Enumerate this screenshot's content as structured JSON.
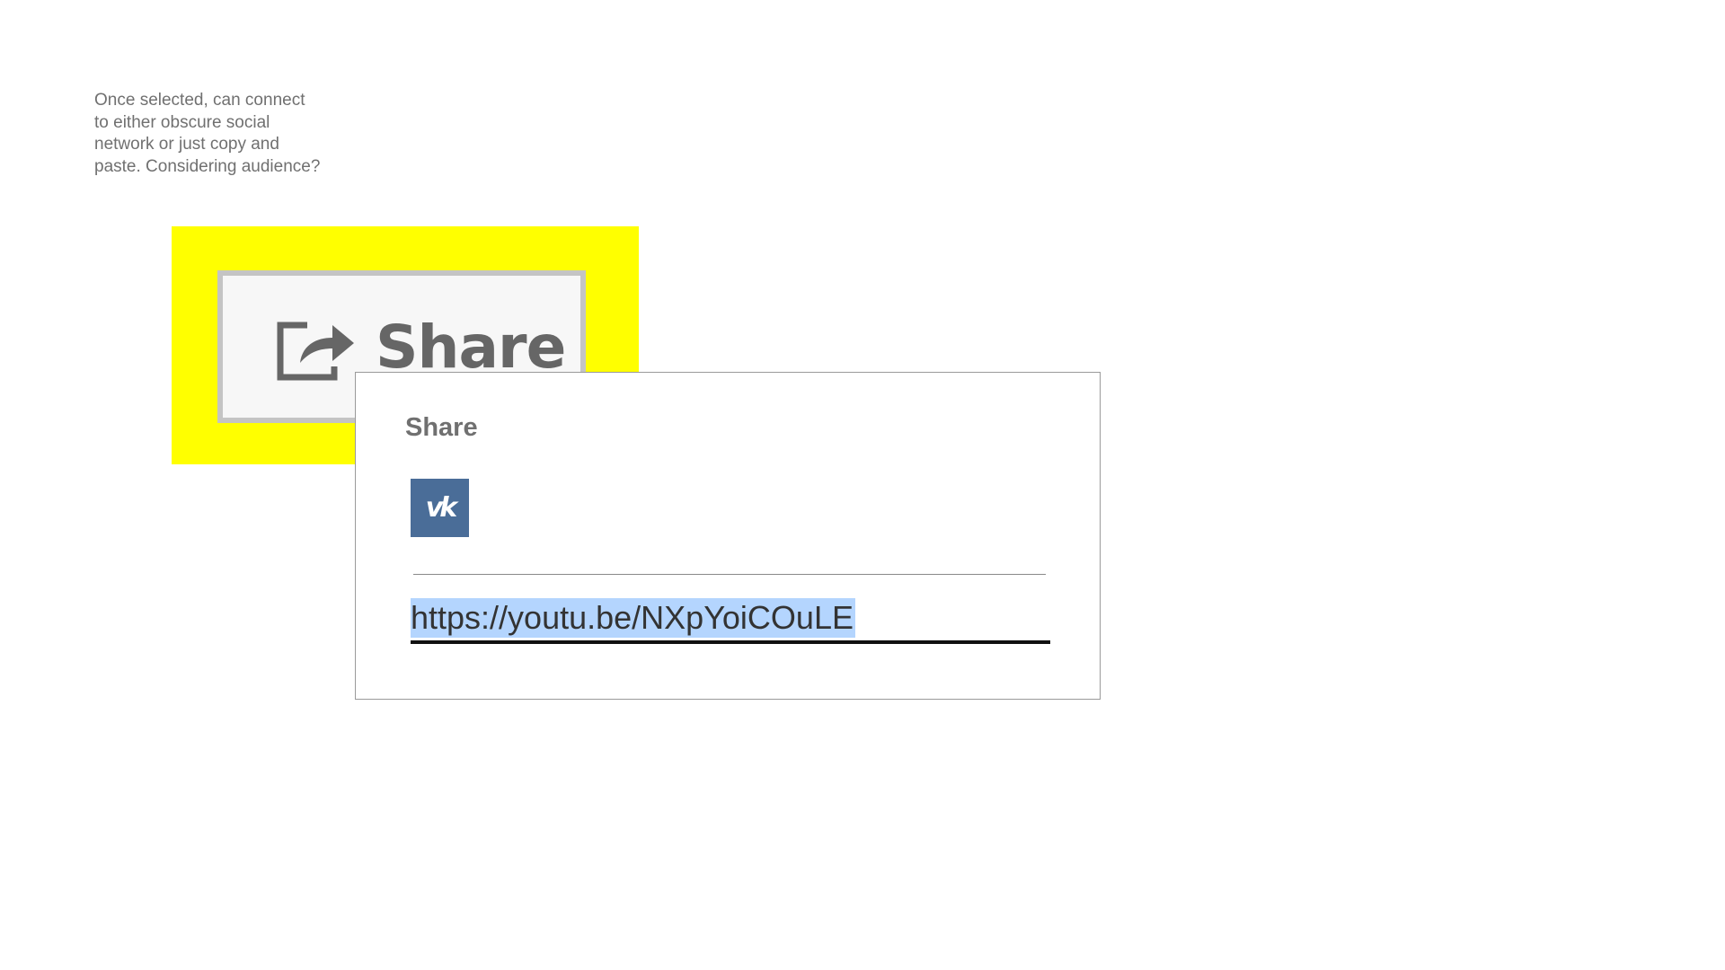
{
  "note": {
    "text": "Once selected, can connect\nto either obscure social\nnetwork or just copy and\npaste. Considering audience?"
  },
  "share_button": {
    "icon": "share-arrow-icon",
    "label": "Share"
  },
  "share_dialog": {
    "title": "Share",
    "social": [
      {
        "icon": "vk-icon",
        "glyph": "vk",
        "color": "#4a6d98"
      }
    ],
    "url": {
      "value": "https://youtu.be/NXpYoiCOuLE",
      "selected": true,
      "highlight_color": "#b4d5fe"
    }
  },
  "colors": {
    "highlight": "#ffff00",
    "text_gray": "#707070"
  }
}
